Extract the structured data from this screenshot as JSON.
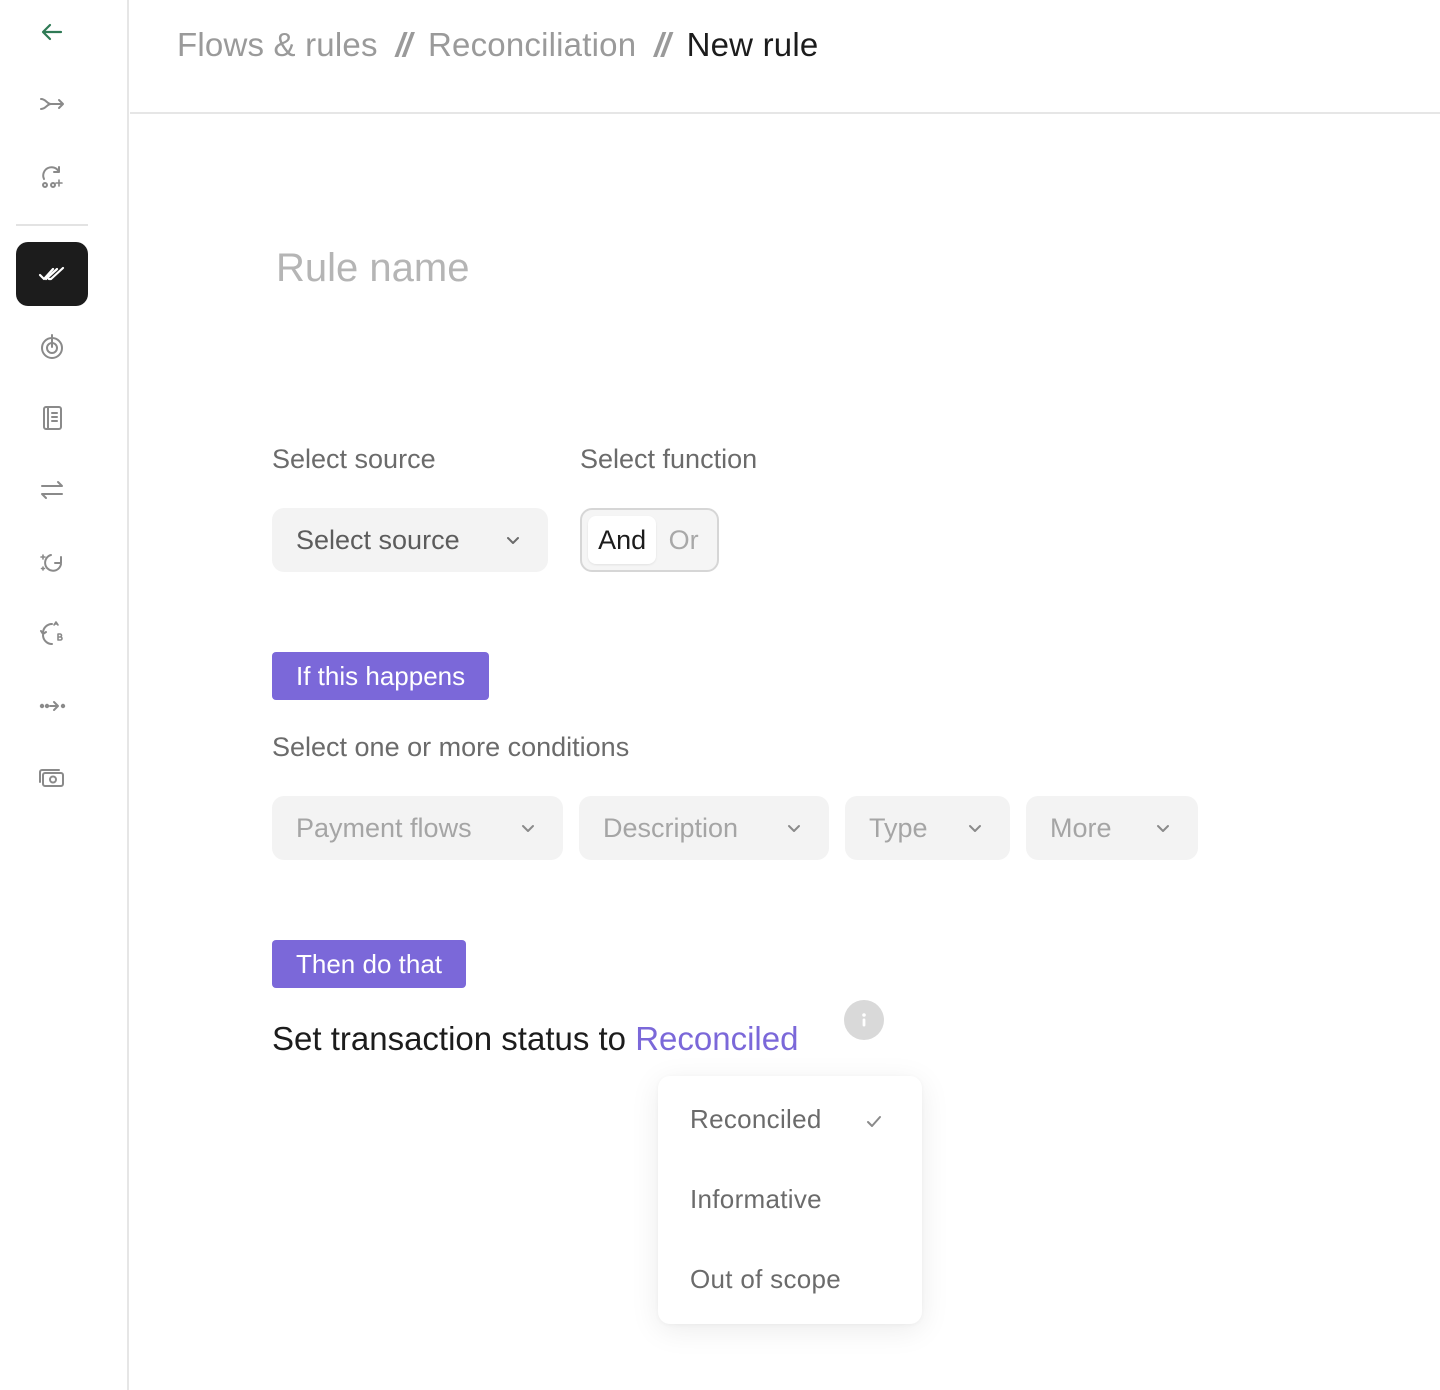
{
  "sidebar": {
    "items": [
      {
        "icon": "back-arrow-icon",
        "color": "#2f7a55"
      },
      {
        "icon": "merge-flow-icon"
      },
      {
        "icon": "cycle-nodes-icon"
      },
      {
        "icon": "double-check-icon",
        "active": true
      },
      {
        "icon": "target-icon"
      },
      {
        "icon": "ledger-book-icon"
      },
      {
        "icon": "transfer-arrows-icon"
      },
      {
        "icon": "sparkle-refresh-icon"
      },
      {
        "icon": "ab-swap-icon"
      },
      {
        "icon": "dotted-flow-icon"
      },
      {
        "icon": "cash-icon"
      }
    ]
  },
  "breadcrumb": {
    "items": [
      "Flows & rules",
      "Reconciliation",
      "New rule"
    ],
    "separator": "//"
  },
  "rule_name": {
    "placeholder": "Rule name",
    "value": ""
  },
  "source": {
    "label": "Select source",
    "select_value": "Select source"
  },
  "function": {
    "label": "Select function",
    "options": [
      "And",
      "Or"
    ],
    "selected": "And"
  },
  "conditions": {
    "tag": "If this happens",
    "label": "Select one or more conditions",
    "filters": [
      "Payment flows",
      "Description",
      "Type",
      "More"
    ]
  },
  "actions": {
    "tag": "Then do that",
    "text": "Set transaction status to",
    "status_value": "Reconciled"
  },
  "status_menu": {
    "options": [
      "Reconciled",
      "Informative",
      "Out of scope"
    ],
    "selected": "Reconciled"
  },
  "colors": {
    "accent": "#7b68d9",
    "back": "#2f7a55",
    "active_nav": "#1c1c1c"
  }
}
